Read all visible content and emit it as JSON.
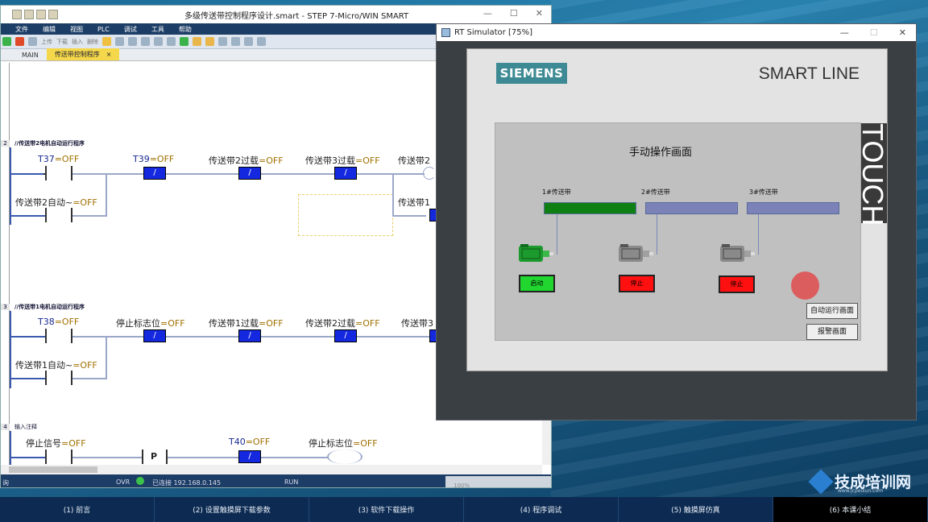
{
  "step7": {
    "title": "多级传送带控制程序设计.smart - STEP 7-Micro/WIN SMART",
    "menu": [
      "文件",
      "编辑",
      "视图",
      "PLC",
      "调试",
      "工具",
      "帮助"
    ],
    "toolbar": [
      "上传",
      "下载",
      "插入",
      "删除"
    ],
    "tabs": {
      "main": "MAIN",
      "active": "传送带控制程序",
      "close": "×"
    },
    "networks": {
      "n2": {
        "num": "2",
        "comment": "//传送带2电机自动运行程序"
      },
      "n3": {
        "num": "3",
        "comment": "//传送带1电机自动运行程序"
      },
      "n4": {
        "num": "4",
        "comment": "输入注释"
      }
    },
    "labels": {
      "t37": "T37",
      "t39": "T39",
      "t38": "T38",
      "t40": "T40",
      "off": "=OFF",
      "belt2_overload": "传送带2过载",
      "belt3_overload": "传送带3过载",
      "belt1_overload": "传送带1过载",
      "belt2_cut": "传送带2",
      "belt2_auto": "传送带2自动~",
      "belt1_cut": "传送带1",
      "belt1_auto": "传送带1自动~",
      "stop_flag": "停止标志位",
      "stop_signal": "停止信号",
      "belt3_cut": "传送带3",
      "p": "P",
      "slash": "/"
    },
    "status": {
      "left": "询",
      "ovr": "OVR",
      "connected": "已连接 192.168.0.145",
      "run": "RUN",
      "zoom": "100%"
    }
  },
  "simulator": {
    "title": "RT Simulator [75%]",
    "brand": "SIEMENS",
    "model": "SMART LINE",
    "touch": "TOUCH",
    "screen_title": "手动操作画面",
    "belts": [
      {
        "label": "1#传送带",
        "color": "#0e7f12"
      },
      {
        "label": "2#传送带",
        "color": "#7a82b8"
      },
      {
        "label": "3#传送带",
        "color": "#7a82b8"
      }
    ],
    "buttons": [
      {
        "label": "启动",
        "color": "#22d630"
      },
      {
        "label": "停止",
        "color": "#ff1010"
      },
      {
        "label": "停止",
        "color": "#ff1010"
      }
    ],
    "nav": {
      "auto": "自动运行画面",
      "alarm": "报警画面"
    }
  },
  "bottom_nav": [
    "(1) 前言",
    "(2) 设置触摸屏下载参数",
    "(3) 软件下载操作",
    "(4) 程序调试",
    "(5) 触摸屏仿真",
    "(6) 本课小结"
  ],
  "branding": {
    "name": "技成培训网",
    "url": "www.jcpeixun.com"
  }
}
